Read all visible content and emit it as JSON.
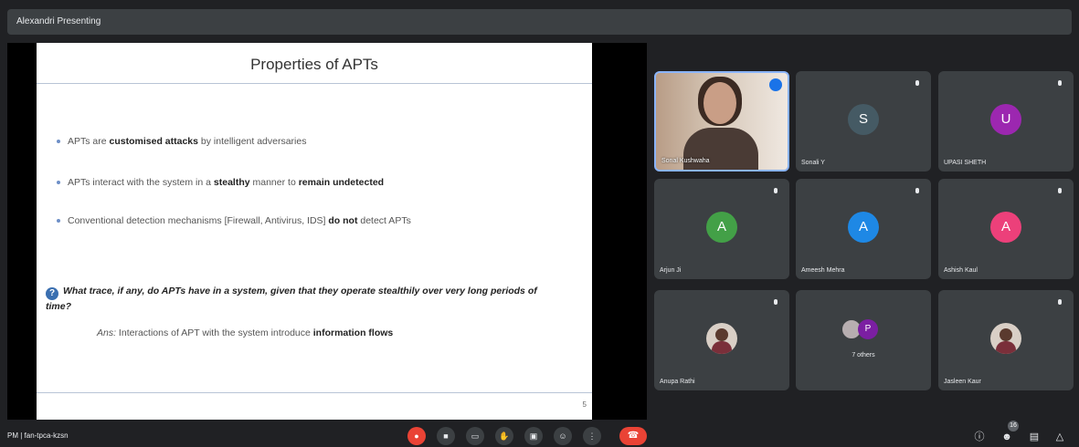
{
  "presenter": {
    "name": "Alexandri Presenting"
  },
  "slide": {
    "title": "Properties of APTs",
    "bullets": [
      {
        "pre": "APTs are ",
        "bold": "customised attacks",
        "post": " by intelligent adversaries"
      },
      {
        "pre": "APTs interact with the system in a ",
        "bold": "stealthy",
        "mid": " manner to ",
        "bold2": "remain undetected",
        "post": ""
      },
      {
        "pre": "Conventional detection mechanisms [Firewall, Antivirus, IDS] ",
        "bold": "do not",
        "post": " detect APTs"
      }
    ],
    "question": "What trace, if any, do APTs have in a system, given that they operate stealthily over very long periods of time?",
    "answer_pre": "Ans:",
    "answer_mid": " Interactions of APT with the system introduce ",
    "answer_bold": "information flows",
    "number": "5"
  },
  "participants": [
    {
      "name": "Sonal Kushwaha",
      "type": "video"
    },
    {
      "name": "Sonali Y",
      "initial": "S",
      "color": "#455a64"
    },
    {
      "name": "UPASI SHETH",
      "initial": "U",
      "color": "#9c27b0"
    },
    {
      "name": "Arjun Ji",
      "initial": "A",
      "color": "#43a047"
    },
    {
      "name": "Ameesh Mehra",
      "initial": "A",
      "color": "#1e88e5"
    },
    {
      "name": "Ashish Kaul",
      "initial": "A",
      "color": "#ec407a"
    },
    {
      "name": "Anupa Rathi",
      "type": "photo"
    },
    {
      "name": "7 others",
      "type": "group",
      "initial": "P"
    },
    {
      "name": "Jasleen Kaur",
      "type": "photo"
    }
  ],
  "bottom": {
    "meeting_info": "PM | fan-tpca-kzsn",
    "controls": [
      "mic-off",
      "camera-off",
      "captions",
      "raise-hand",
      "present",
      "reactions",
      "more"
    ],
    "end_call_icon": "end-call-icon",
    "right_controls": [
      "info",
      "people",
      "chat",
      "activities"
    ],
    "people_count": "16"
  }
}
